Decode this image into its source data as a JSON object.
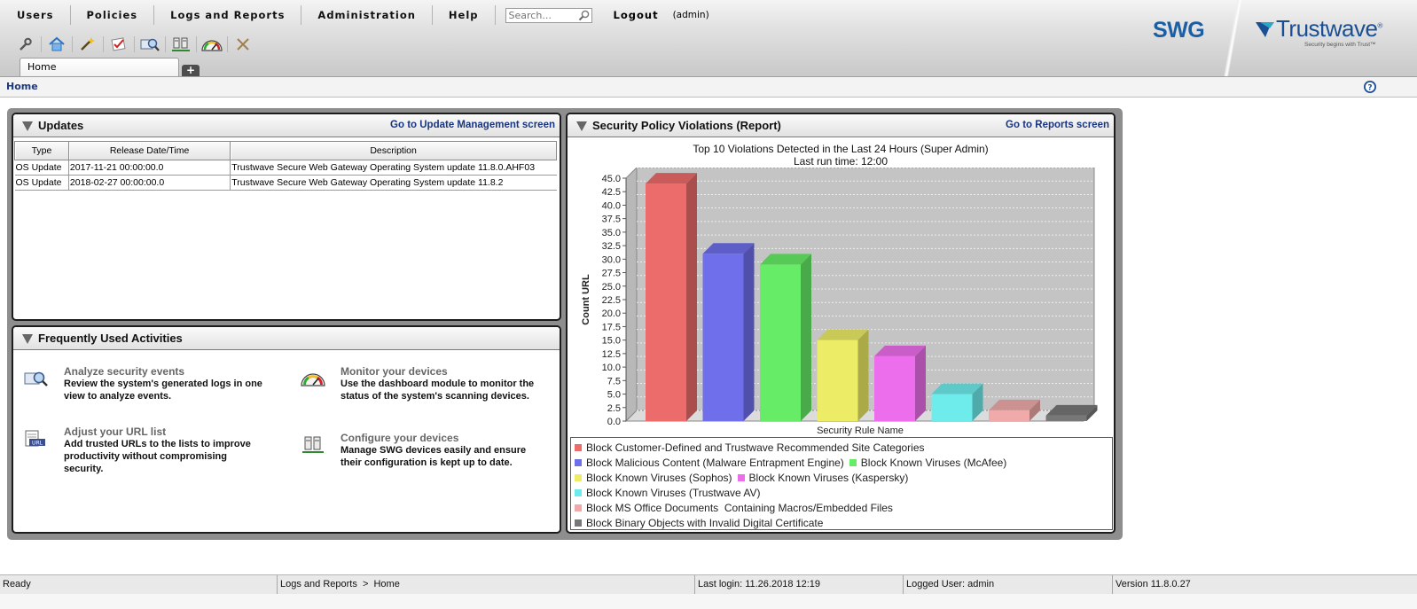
{
  "menu": {
    "items": [
      "Users",
      "Policies",
      "Logs and Reports",
      "Administration",
      "Help"
    ],
    "search_placeholder": "Search...",
    "logout": "Logout",
    "user_tag": "(admin)"
  },
  "toolbar_icons": [
    "wrench-icon",
    "home-icon",
    "wizard-wand-icon",
    "policy-checklist-icon",
    "log-search-icon",
    "devices-icon",
    "dashboard-gauge-icon",
    "tools-icon"
  ],
  "tabs": {
    "home": "Home",
    "add": "+"
  },
  "branding": {
    "product": "SWG",
    "company": "Trustwave",
    "registered": "®",
    "tagline": "Security begins with Trust™"
  },
  "breadcrumb": "Home",
  "updates": {
    "title": "Updates",
    "link": "Go to Update Management screen",
    "columns": [
      "Type",
      "Release Date/Time",
      "Description"
    ],
    "rows": [
      [
        "OS Update",
        "2017-11-21 00:00:00.0",
        "Trustwave Secure Web Gateway Operating System update 11.8.0.AHF03"
      ],
      [
        "OS Update",
        "2018-02-27 00:00:00.0",
        "Trustwave Secure Web Gateway Operating System update 11.8.2"
      ]
    ]
  },
  "activities": {
    "title": "Frequently Used Activities",
    "items": [
      {
        "title": "Analyze security events",
        "desc": "Review the system's generated logs in one view to analyze events.",
        "icon": "log-search-icon"
      },
      {
        "title": "Monitor your devices",
        "desc": "Use the dashboard module to monitor the status of the system's scanning devices.",
        "icon": "dashboard-gauge-icon"
      },
      {
        "title": "Adjust your URL list",
        "desc": "Add trusted URLs to the lists to improve productivity without compromising security.",
        "icon": "url-list-icon"
      },
      {
        "title": "Configure your devices",
        "desc": "Manage SWG devices easily and ensure their configuration is kept up to date.",
        "icon": "devices-icon"
      }
    ]
  },
  "report": {
    "title": "Security Policy Violations (Report)",
    "link": "Go to Reports screen"
  },
  "chart_data": {
    "type": "bar",
    "title": "Top 10 Violations Detected in the Last 24 Hours (Super Admin)",
    "subtitle": "Last run time: 12:00",
    "xlabel": "Security Rule Name",
    "ylabel": "Count URL",
    "ylim": [
      0,
      45
    ],
    "yticks": [
      "0.0",
      "2.5",
      "5.0",
      "7.5",
      "10.0",
      "12.5",
      "15.0",
      "17.5",
      "20.0",
      "22.5",
      "25.0",
      "27.5",
      "30.0",
      "32.5",
      "35.0",
      "37.5",
      "40.0",
      "42.5",
      "45.0"
    ],
    "grid": true,
    "legend_position": "bottom",
    "categories": [
      "Block Customer-Defined and Trustwave Recommended Site Categories",
      "Block Malicious Content (Malware Entrapment Engine)",
      "Block Known Viruses (McAfee)",
      "Block Known Viruses (Sophos)",
      "Block Known Viruses (Kaspersky)",
      "Block Known Viruses (Trustwave AV)",
      "Block MS Office Documents  Containing Macros/Embedded Files",
      "Block Binary Objects with Invalid Digital Certificate"
    ],
    "values": [
      44,
      31,
      29,
      15,
      12,
      5,
      2,
      1
    ],
    "colors": [
      "#ec6b6b",
      "#6f6fec",
      "#66ec66",
      "#ecec66",
      "#ec6eec",
      "#6eecec",
      "#f0aaaa",
      "#777777"
    ]
  },
  "status": {
    "ready": "Ready",
    "path": "Logs and Reports  >  Home",
    "last_login": "Last login: 11.26.2018 12:19",
    "logged_user": "Logged User: admin",
    "version": "Version 11.8.0.27"
  }
}
